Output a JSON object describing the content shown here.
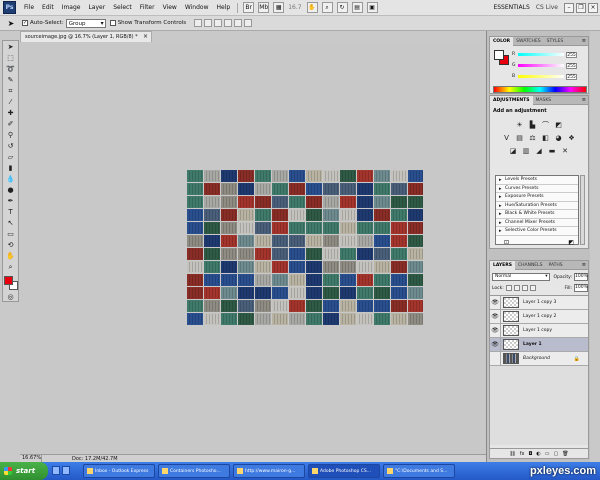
{
  "menubar": {
    "logo": "Ps",
    "items": [
      "File",
      "Edit",
      "Image",
      "Layer",
      "Select",
      "Filter",
      "View",
      "Window",
      "Help"
    ],
    "zoom_value": "16.7",
    "workspace": "ESSENTIALS",
    "cs_live": "CS Live"
  },
  "optionsbar": {
    "auto_select_label": "Auto-Select:",
    "auto_select_value": "Group",
    "show_transform_label": "Show Transform Controls"
  },
  "document": {
    "tab_title": "sourceimage.jpg @ 16.7% (Layer 1, RGB/8) *"
  },
  "status": {
    "zoom": "16.67%",
    "doc_info": "Doc: 17.2M/42.7M"
  },
  "color_panel": {
    "tabs": [
      "COLOR",
      "SWATCHES",
      "STYLES"
    ],
    "channels": [
      {
        "label": "R",
        "value": "255"
      },
      {
        "label": "G",
        "value": "255"
      },
      {
        "label": "B",
        "value": "255"
      }
    ]
  },
  "adjustments_panel": {
    "tabs": [
      "ADJUSTMENTS",
      "MASKS"
    ],
    "title": "Add an adjustment",
    "presets": [
      "Levels Presets",
      "Curves Presets",
      "Exposure Presets",
      "Hue/Saturation Presets",
      "Black & White Presets",
      "Channel Mixer Presets",
      "Selective Color Presets"
    ]
  },
  "layers_panel": {
    "tabs": [
      "LAYERS",
      "CHANNELS",
      "PATHS"
    ],
    "blend_mode": "Normal",
    "opacity_label": "Opacity:",
    "opacity_value": "100%",
    "lock_label": "Lock:",
    "fill_label": "Fill:",
    "fill_value": "100%",
    "layers": [
      {
        "name": "Layer 1 copy 3",
        "visible": true,
        "selected": false
      },
      {
        "name": "Layer 1 copy 2",
        "visible": true,
        "selected": false
      },
      {
        "name": "Layer 1 copy",
        "visible": true,
        "selected": false
      },
      {
        "name": "Layer 1",
        "visible": true,
        "selected": true
      },
      {
        "name": "Background",
        "visible": false,
        "selected": false
      }
    ]
  },
  "taskbar": {
    "start": "start",
    "tasks": [
      "Inbox - Outlook Express",
      "Containers Photosho...",
      "http://www.mairon-g...",
      "Adobe Photoshop CS...",
      "\"C:\\Documents and S..."
    ],
    "watermark": "pxleyes.com"
  },
  "image": {
    "colors": [
      "#2a4f8f",
      "#1e3a70",
      "#8a2d26",
      "#a3352c",
      "#2f5a45",
      "#3f7a6a",
      "#a8a8a4",
      "#c4c2bc",
      "#8f8c84",
      "#6e8c8f",
      "#b8b3a2",
      "#4a5f7a"
    ]
  }
}
